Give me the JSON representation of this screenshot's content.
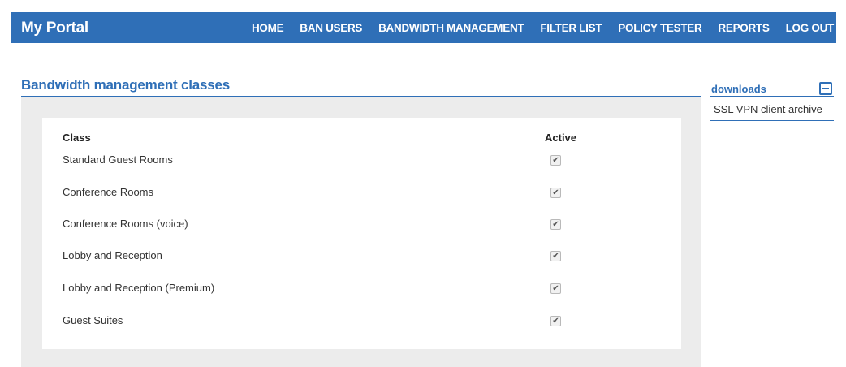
{
  "header": {
    "brand": "My Portal",
    "nav": [
      "HOME",
      "BAN USERS",
      "BANDWIDTH MANAGEMENT",
      "FILTER LIST",
      "POLICY TESTER",
      "REPORTS",
      "LOG OUT"
    ]
  },
  "main": {
    "title": "Bandwidth management classes",
    "table": {
      "headers": {
        "class": "Class",
        "active": "Active"
      },
      "rows": [
        {
          "class": "Standard Guest Rooms",
          "active": true
        },
        {
          "class": "Conference Rooms",
          "active": true
        },
        {
          "class": "Conference Rooms (voice)",
          "active": true
        },
        {
          "class": "Lobby and Reception",
          "active": true
        },
        {
          "class": "Lobby and Reception (Premium)",
          "active": true
        },
        {
          "class": "Guest Suites",
          "active": true
        }
      ]
    }
  },
  "sidebar": {
    "title": "downloads",
    "toggle_icon": "collapse-minus-icon",
    "items": [
      "SSL VPN client archive"
    ]
  },
  "colors": {
    "accent": "#2f6fb7",
    "panel_bg": "#ececec"
  }
}
